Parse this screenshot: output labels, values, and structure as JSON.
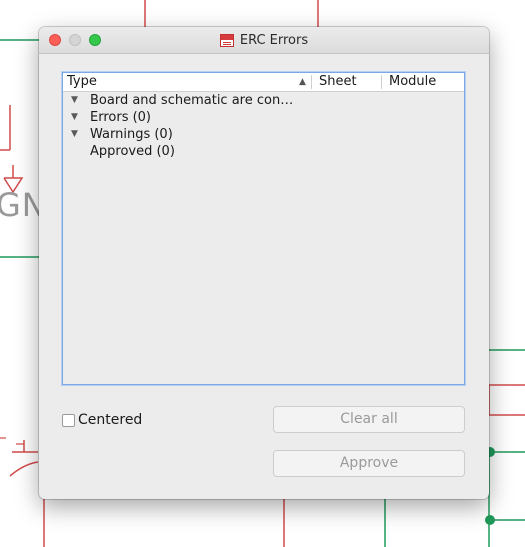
{
  "background": {
    "gnd_text": "GNI",
    "wire_color": "#d24b4b",
    "net_color": "#1f9a5a"
  },
  "window": {
    "title": "ERC Errors",
    "app_icon": "kicad-schematic-icon"
  },
  "list": {
    "columns": {
      "type": "Type",
      "sheet": "Sheet",
      "module": "Module"
    },
    "rows": [
      {
        "label": "Board and schematic are con…",
        "expanded": true
      },
      {
        "label": "Errors (0)",
        "expanded": true
      },
      {
        "label": "Warnings (0)",
        "expanded": true
      },
      {
        "label": "Approved (0)",
        "expanded": false
      }
    ]
  },
  "options": {
    "centered_label": "Centered",
    "centered_checked": false
  },
  "buttons": {
    "clear_all": "Clear all",
    "approve": "Approve"
  }
}
